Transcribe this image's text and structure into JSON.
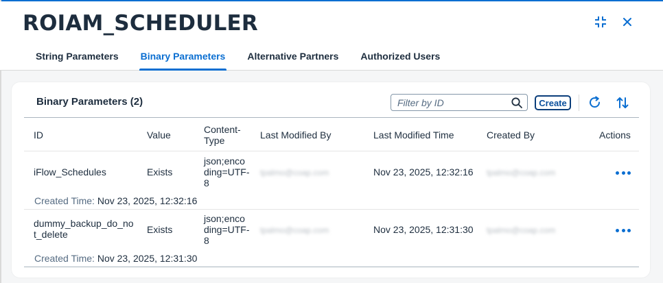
{
  "window": {
    "title": "ROIAM_SCHEDULER",
    "expand_icon": "exit-fullscreen-icon",
    "close_icon": "close-icon"
  },
  "tabs": [
    {
      "label": "String Parameters",
      "active": false
    },
    {
      "label": "Binary Parameters",
      "active": true
    },
    {
      "label": "Alternative Partners",
      "active": false
    },
    {
      "label": "Authorized Users",
      "active": false
    }
  ],
  "section": {
    "title": "Binary Parameters (2)",
    "search_placeholder": "Filter by ID",
    "search_value": "",
    "create_label": "Create"
  },
  "table": {
    "columns": [
      "ID",
      "Value",
      "Content-Type",
      "Last Modified By",
      "Last Modified Time",
      "Created By",
      "Actions"
    ],
    "column_lines": {
      "content_type": [
        "Content-",
        "Type"
      ]
    },
    "created_time_label": "Created Time:",
    "rows": [
      {
        "id_lines": [
          "iFlow_Schedules"
        ],
        "value": "Exists",
        "content_type_lines": [
          "json;enco",
          "ding=UTF-",
          "8"
        ],
        "last_modified_by": "tpalmo@coap.com",
        "last_modified_time": "Nov 23, 2025, 12:32:16",
        "created_by": "tpalmo@coap.com",
        "created_time": "Nov 23, 2025, 12:32:16"
      },
      {
        "id_lines": [
          "dummy_backup_do_no",
          "t_delete"
        ],
        "value": "Exists",
        "content_type_lines": [
          "json;enco",
          "ding=UTF-",
          "8"
        ],
        "last_modified_by": "tpalmo@coap.com",
        "last_modified_time": "Nov 23, 2025, 12:31:30",
        "created_by": "tpalmo@coap.com",
        "created_time": "Nov 23, 2025, 12:31:30"
      }
    ]
  },
  "colors": {
    "accent": "#0a6ed1",
    "text": "#1d2d3e",
    "muted": "#556b82",
    "background": "#f5f6f7"
  }
}
